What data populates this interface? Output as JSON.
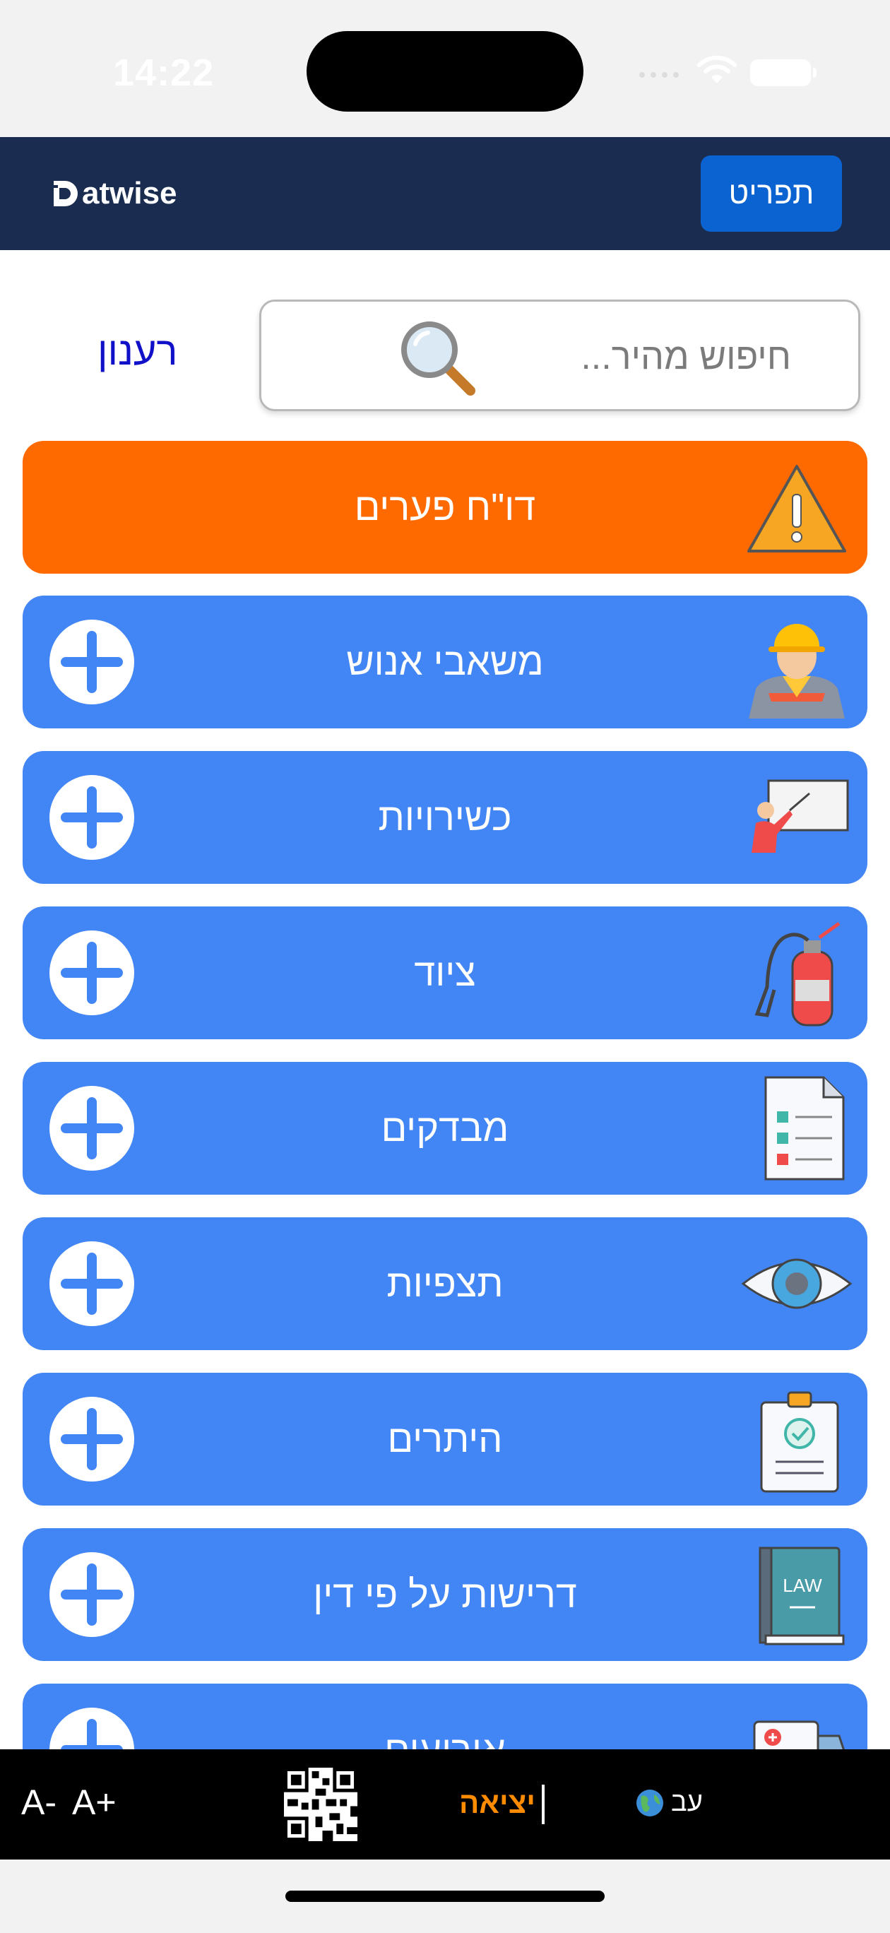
{
  "status_bar": {
    "time": "14:22"
  },
  "header": {
    "logo_text": "atwise",
    "logo_letter": "D",
    "menu_label": "תפריט"
  },
  "search": {
    "placeholder": "חיפוש מהיר..."
  },
  "city": "רענון",
  "alert_tile": {
    "label": "דו\"ח פערים",
    "icon": "warning-icon"
  },
  "tiles": [
    {
      "label": "משאבי אנוש",
      "icon": "worker-icon"
    },
    {
      "label": "כשירויות",
      "icon": "training-icon"
    },
    {
      "label": "ציוד",
      "icon": "fire-extinguisher-icon"
    },
    {
      "label": "מבדקים",
      "icon": "checklist-icon"
    },
    {
      "label": "תצפיות",
      "icon": "eye-icon"
    },
    {
      "label": "היתרים",
      "icon": "permit-clipboard-icon"
    },
    {
      "label": "דרישות על פי דין",
      "icon": "law-book-icon"
    },
    {
      "label": "אירועים",
      "icon": "first-aid-icon"
    }
  ],
  "bottom_bar": {
    "font_decrease": "A-",
    "font_increase": "A+",
    "exit_label": "יציאה",
    "language_label": "עב"
  },
  "colors": {
    "header": "#1a2c4f",
    "tile_blue": "#4285f4",
    "tile_orange": "#ff6a00",
    "menu_button": "#0b62d1",
    "exit": "#ff8c00"
  }
}
